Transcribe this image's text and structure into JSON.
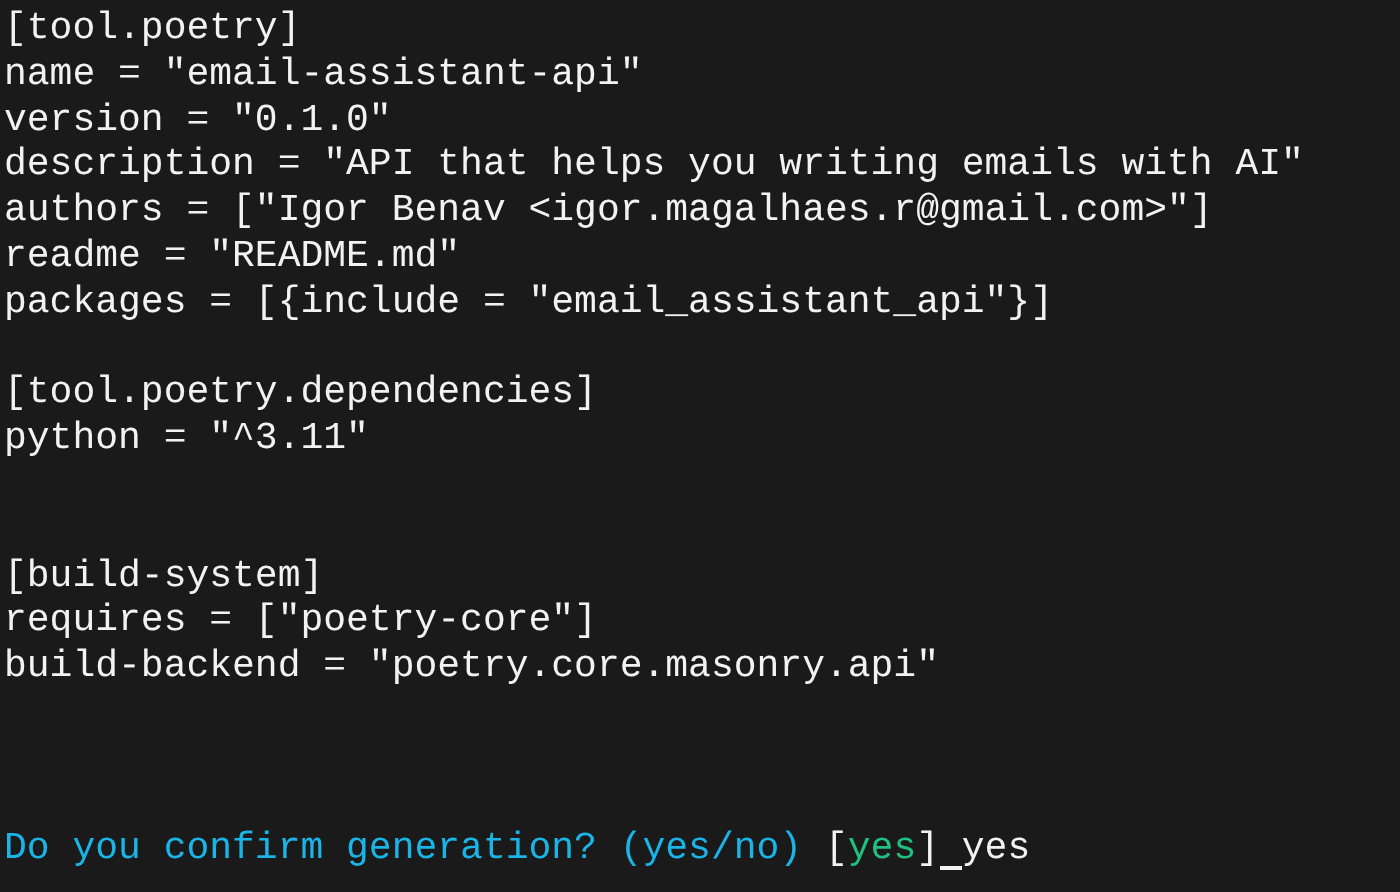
{
  "lines": [
    {
      "kind": "text",
      "text": "[tool.poetry]"
    },
    {
      "kind": "text",
      "text": "name = \"email-assistant-api\""
    },
    {
      "kind": "text",
      "text": "version = \"0.1.0\""
    },
    {
      "kind": "text",
      "text": "description = \"API that helps you writing emails with AI\""
    },
    {
      "kind": "text",
      "text": "authors = [\"Igor Benav <igor.magalhaes.r@gmail.com>\"]"
    },
    {
      "kind": "text",
      "text": "readme = \"README.md\""
    },
    {
      "kind": "text",
      "text": "packages = [{include = \"email_assistant_api\"}]"
    },
    {
      "kind": "blank"
    },
    {
      "kind": "text",
      "text": "[tool.poetry.dependencies]"
    },
    {
      "kind": "text",
      "text": "python = \"^3.11\""
    },
    {
      "kind": "blank"
    },
    {
      "kind": "blank"
    },
    {
      "kind": "text",
      "text": "[build-system]"
    },
    {
      "kind": "text",
      "text": "requires = [\"poetry-core\"]"
    },
    {
      "kind": "text",
      "text": "build-backend = \"poetry.core.masonry.api\""
    },
    {
      "kind": "blank"
    },
    {
      "kind": "blank"
    },
    {
      "kind": "blank"
    },
    {
      "kind": "prompt",
      "question": "Do you confirm generation? (yes/no)",
      "open_bracket": "[",
      "default": "yes",
      "close_bracket": "]",
      "answer": "yes"
    }
  ]
}
